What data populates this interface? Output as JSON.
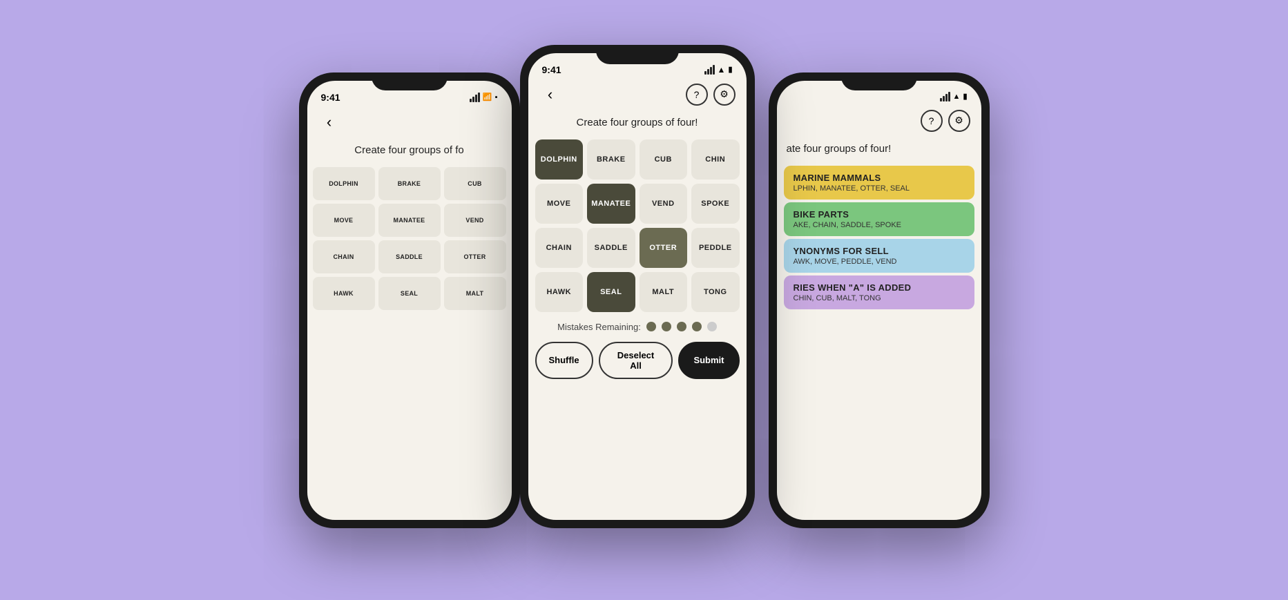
{
  "background_color": "#b8a9e8",
  "phones": {
    "left": {
      "status_time": "9:41",
      "instruction": "Create four groups of fo",
      "words_row1": [
        "DOLPHIN",
        "BRAKE",
        "CUB"
      ],
      "words_row2": [
        "MOVE",
        "MANATEE",
        "VEND"
      ],
      "words_row3": [
        "CHAIN",
        "SADDLE",
        "OTTER"
      ],
      "words_row4": [
        "HAWK",
        "SEAL",
        "MALT"
      ]
    },
    "center": {
      "status_time": "9:41",
      "instruction": "Create four groups of four!",
      "words": [
        {
          "label": "DOLPHIN",
          "state": "selected-dark"
        },
        {
          "label": "BRAKE",
          "state": "normal"
        },
        {
          "label": "CUB",
          "state": "normal"
        },
        {
          "label": "CHIN",
          "state": "normal"
        },
        {
          "label": "MOVE",
          "state": "normal"
        },
        {
          "label": "MANATEE",
          "state": "selected-dark"
        },
        {
          "label": "VEND",
          "state": "normal"
        },
        {
          "label": "SPOKE",
          "state": "normal"
        },
        {
          "label": "CHAIN",
          "state": "normal"
        },
        {
          "label": "SADDLE",
          "state": "normal"
        },
        {
          "label": "OTTER",
          "state": "selected-medium"
        },
        {
          "label": "PEDDLE",
          "state": "normal"
        },
        {
          "label": "HAWK",
          "state": "normal"
        },
        {
          "label": "SEAL",
          "state": "selected-dark"
        },
        {
          "label": "MALT",
          "state": "normal"
        },
        {
          "label": "TONG",
          "state": "normal"
        }
      ],
      "mistakes_label": "Mistakes Remaining:",
      "mistakes_count": 4,
      "buttons": {
        "shuffle": "Shuffle",
        "deselect": "Deselect All",
        "submit": "Submit"
      }
    },
    "right": {
      "status_time": "",
      "instruction": "ate four groups of four!",
      "categories": [
        {
          "title": "MARINE MAMMALS",
          "words": "LPHIN, MANATEE, OTTER, SEAL",
          "color": "yellow"
        },
        {
          "title": "BIKE PARTS",
          "words": "AKE, CHAIN, SADDLE, SPOKE",
          "color": "green"
        },
        {
          "title": "YNONYMS FOR SELL",
          "words": "AWK, MOVE, PEDDLE, VEND",
          "color": "blue"
        },
        {
          "title": "RIES WHEN \"A\" IS ADDED",
          "words": "CHIN, CUB, MALT, TONG",
          "color": "purple"
        }
      ]
    }
  },
  "icons": {
    "back_arrow": "‹",
    "question_mark": "?",
    "settings_gear": "⚙",
    "signal": "▋▋▋",
    "wifi": "wifi",
    "battery": "battery"
  }
}
